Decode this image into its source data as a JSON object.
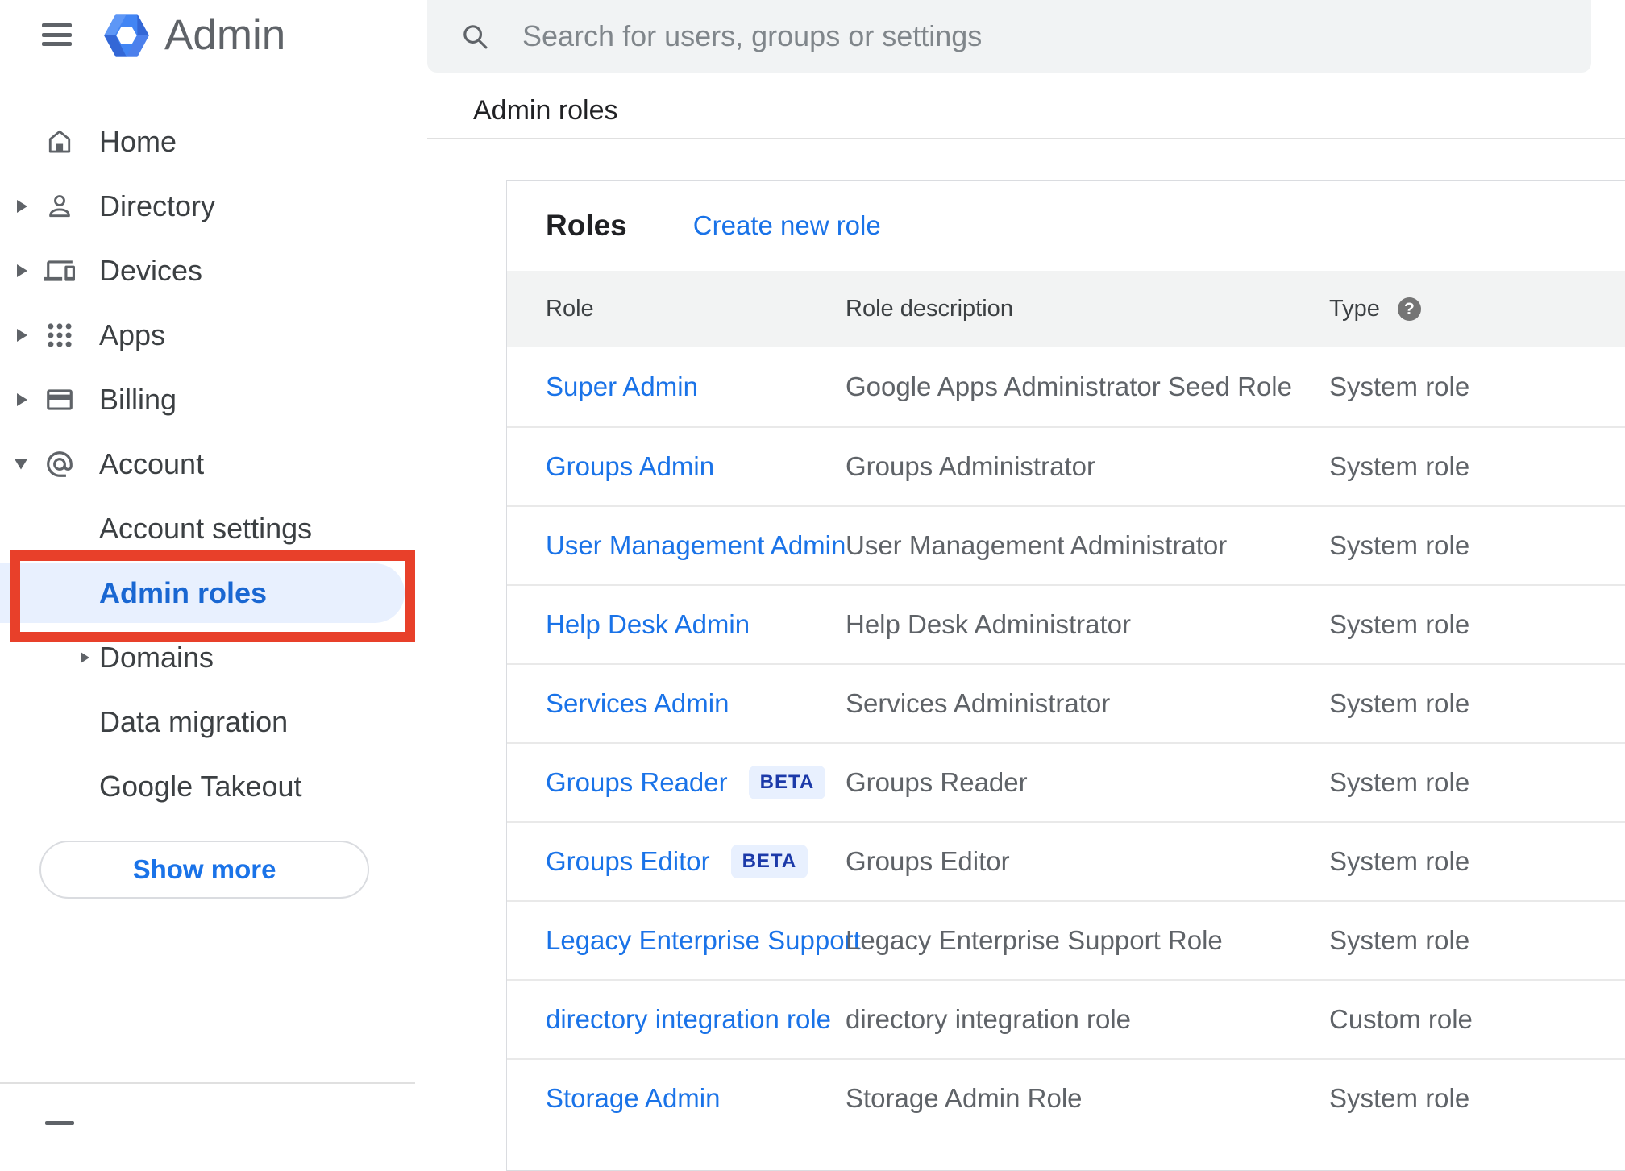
{
  "app": {
    "product_name": "Admin"
  },
  "search": {
    "placeholder": "Search for users, groups or settings"
  },
  "breadcrumb": "Admin roles",
  "sidebar": {
    "items": [
      {
        "label": "Home",
        "icon": "home",
        "expandable": false
      },
      {
        "label": "Directory",
        "icon": "person",
        "expandable": true
      },
      {
        "label": "Devices",
        "icon": "devices",
        "expandable": true
      },
      {
        "label": "Apps",
        "icon": "apps-grid",
        "expandable": true
      },
      {
        "label": "Billing",
        "icon": "credit-card",
        "expandable": true
      },
      {
        "label": "Account",
        "icon": "at-sign",
        "expandable": true,
        "expanded": true
      }
    ],
    "account_children": [
      {
        "label": "Account settings"
      },
      {
        "label": "Admin roles",
        "selected": true
      },
      {
        "label": "Domains",
        "expandable": true
      },
      {
        "label": "Data migration"
      },
      {
        "label": "Google Takeout"
      }
    ],
    "show_more_label": "Show more"
  },
  "main": {
    "card_title": "Roles",
    "create_link": "Create new role",
    "beta_label": "BETA",
    "help_icon_glyph": "?",
    "table": {
      "columns": [
        "Role",
        "Role description",
        "Type"
      ],
      "rows": [
        {
          "role": "Super Admin",
          "beta": false,
          "description": "Google Apps Administrator Seed Role",
          "type": "System role"
        },
        {
          "role": "Groups Admin",
          "beta": false,
          "description": "Groups Administrator",
          "type": "System role"
        },
        {
          "role": "User Management Admin",
          "beta": false,
          "description": "User Management Administrator",
          "type": "System role"
        },
        {
          "role": "Help Desk Admin",
          "beta": false,
          "description": "Help Desk Administrator",
          "type": "System role"
        },
        {
          "role": "Services Admin",
          "beta": false,
          "description": "Services Administrator",
          "type": "System role"
        },
        {
          "role": "Groups Reader",
          "beta": true,
          "description": "Groups Reader",
          "type": "System role"
        },
        {
          "role": "Groups Editor",
          "beta": true,
          "description": "Groups Editor",
          "type": "System role"
        },
        {
          "role": "Legacy Enterprise Support",
          "beta": false,
          "description": "Legacy Enterprise Support Role",
          "type": "System role"
        },
        {
          "role": "directory integration role",
          "beta": false,
          "description": "directory integration role",
          "type": "Custom role"
        },
        {
          "role": "Storage Admin",
          "beta": false,
          "description": "Storage Admin Role",
          "type": "System role"
        }
      ]
    }
  },
  "colors": {
    "accent_blue": "#1a73e8",
    "selected_blue": "#1967d2",
    "beta_text": "#1c3aa9",
    "beta_bg": "#e8f0fe",
    "highlight_bg": "#e8f0fe",
    "annotation_red": "#e8402a",
    "header_bg": "#f2f3f3",
    "searchbar_bg": "#f1f3f4",
    "border_gray": "#e0e0e0",
    "row_border": "#e9e9e9",
    "card_border": "#dadce0",
    "text_dark": "#3c4043",
    "text_gray": "#5f6368",
    "text_black": "#202124",
    "placeholder_gray": "#80868b",
    "help_bg": "#757575"
  }
}
